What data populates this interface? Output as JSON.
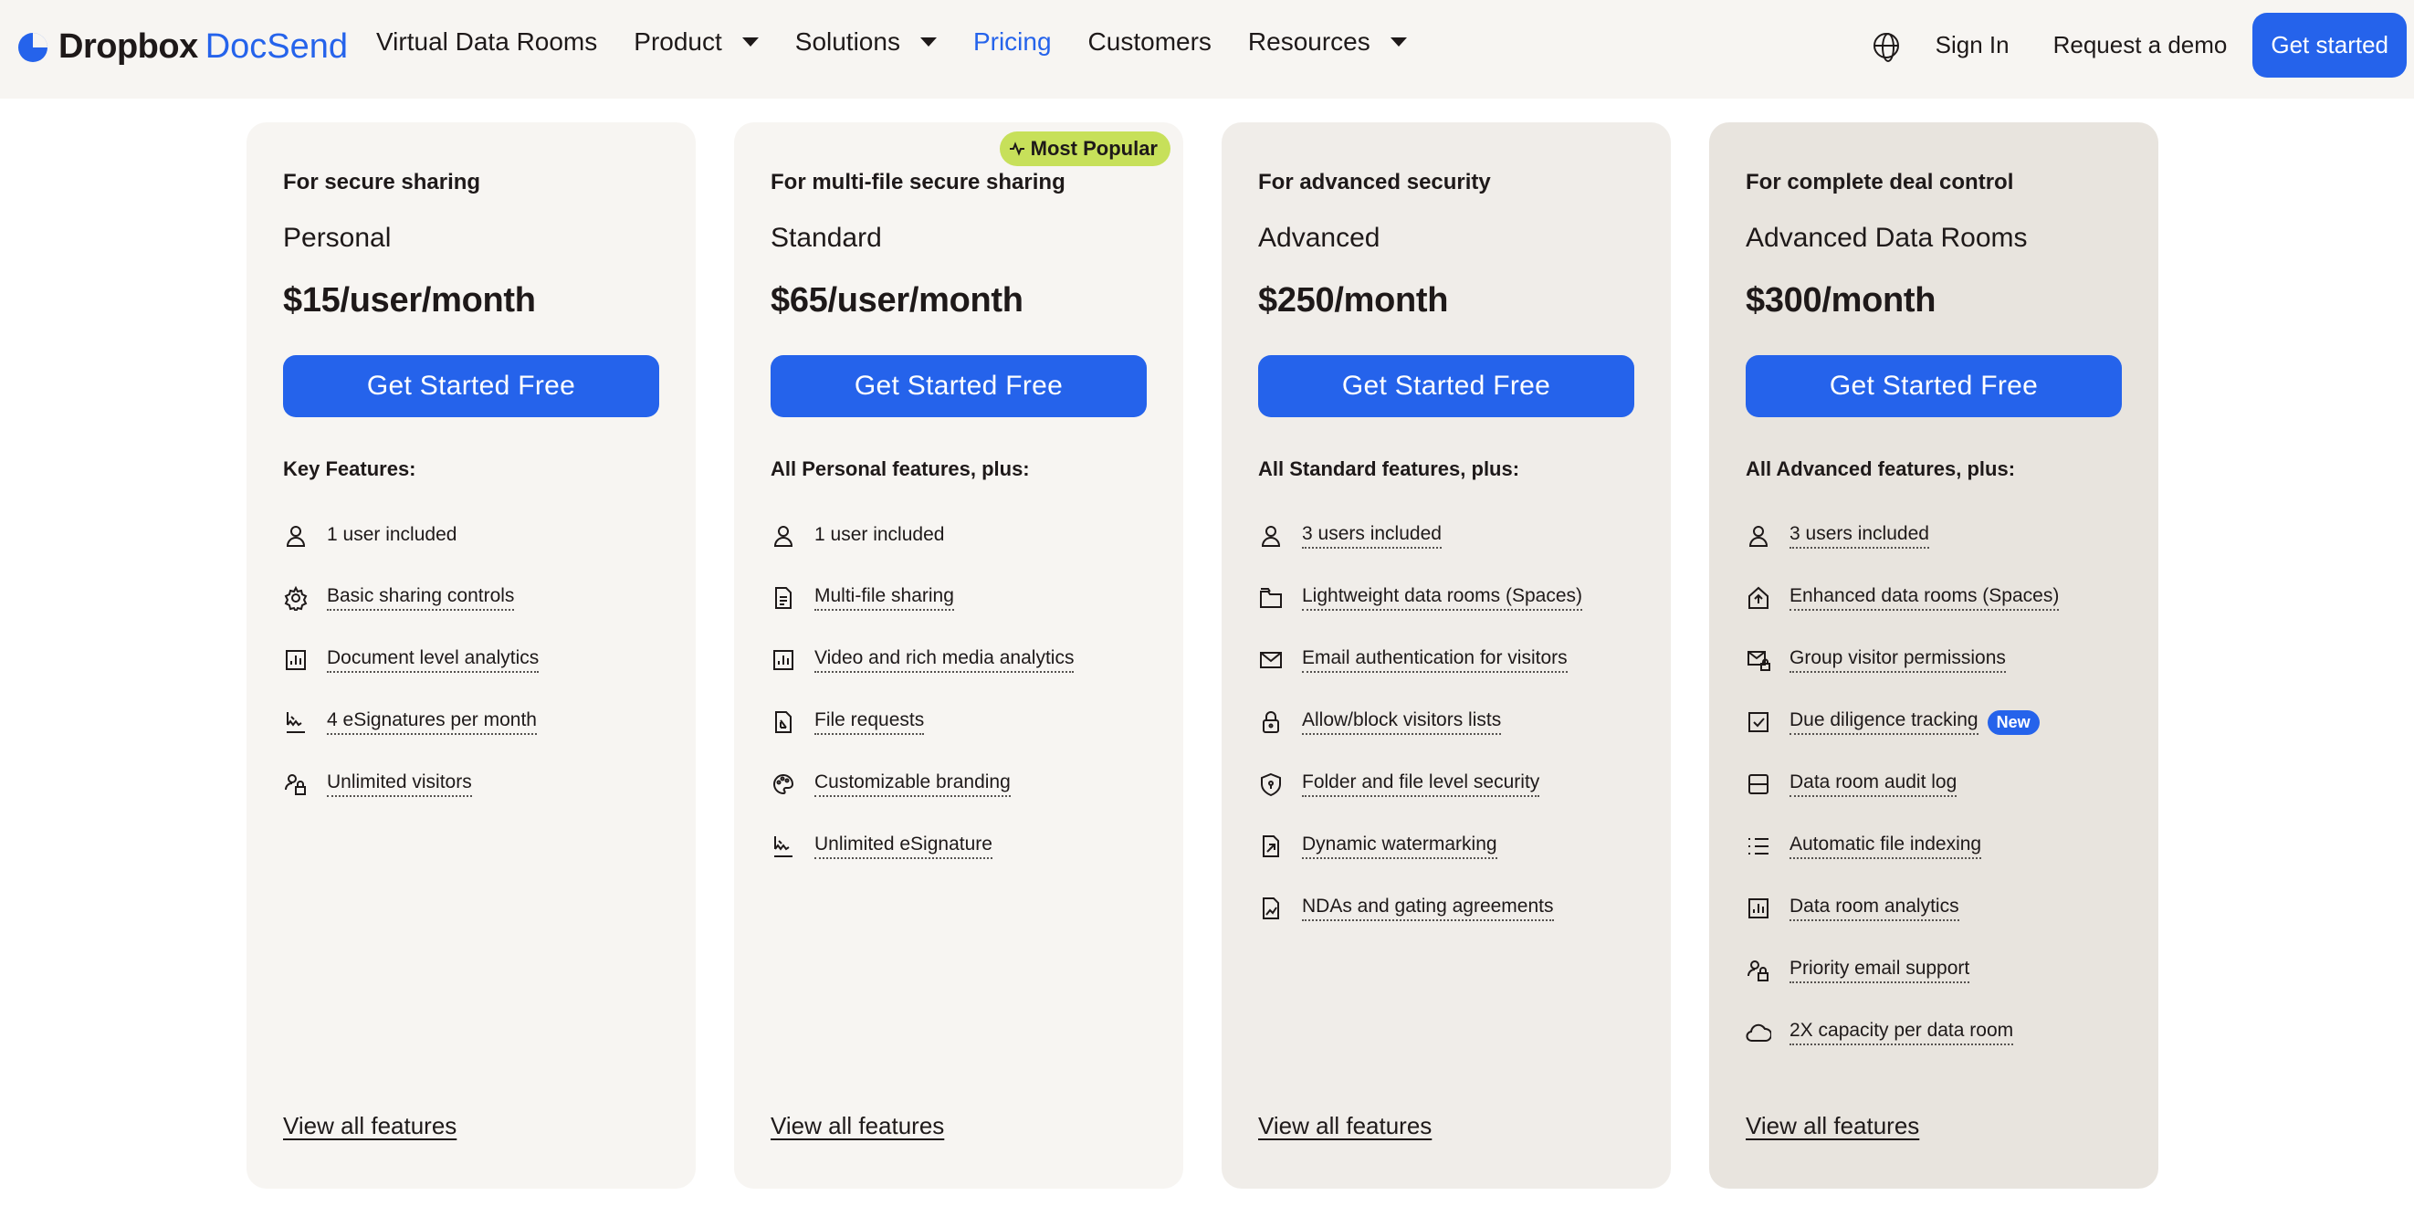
{
  "nav": {
    "logo_brand": "Dropbox",
    "logo_product": "DocSend",
    "links": [
      {
        "label": "Virtual Data Rooms",
        "dropdown": false,
        "active": false
      },
      {
        "label": "Product",
        "dropdown": true,
        "active": false
      },
      {
        "label": "Solutions",
        "dropdown": true,
        "active": false
      },
      {
        "label": "Pricing",
        "dropdown": false,
        "active": true
      },
      {
        "label": "Customers",
        "dropdown": false,
        "active": false
      },
      {
        "label": "Resources",
        "dropdown": true,
        "active": false
      }
    ],
    "sign_in": "Sign In",
    "request_demo": "Request a demo",
    "get_started": "Get started",
    "globe_icon": "globe-icon"
  },
  "colors": {
    "accent": "#2563eb",
    "badge": "#c7e05a",
    "text": "#1e1919"
  },
  "plans": [
    {
      "tagline": "For secure sharing",
      "name": "Personal",
      "price": "$15/user/month",
      "cta": "Get Started Free",
      "features_heading": "Key Features:",
      "features": [
        {
          "label": "1 user included",
          "icon": "user-icon",
          "underline": false
        },
        {
          "label": "Basic sharing controls",
          "icon": "gear-icon",
          "underline": true
        },
        {
          "label": "Document level analytics",
          "icon": "chart-icon",
          "underline": true
        },
        {
          "label": "4 eSignatures per month",
          "icon": "signature-icon",
          "underline": true
        },
        {
          "label": "Unlimited visitors",
          "icon": "visitors-icon",
          "underline": true
        }
      ],
      "view_all": "View all features"
    },
    {
      "tagline": "For multi-file secure sharing",
      "name": "Standard",
      "price": "$65/user/month",
      "badge": "Most Popular",
      "cta": "Get Started Free",
      "features_heading": "All Personal features, plus:",
      "features": [
        {
          "label": "1 user included",
          "icon": "user-icon",
          "underline": false
        },
        {
          "label": "Multi-file sharing",
          "icon": "document-icon",
          "underline": true
        },
        {
          "label": "Video and rich media analytics",
          "icon": "chart-icon",
          "underline": true
        },
        {
          "label": "File requests",
          "icon": "file-request-icon",
          "underline": true
        },
        {
          "label": "Customizable branding",
          "icon": "palette-icon",
          "underline": true
        },
        {
          "label": "Unlimited eSignature",
          "icon": "signature-icon",
          "underline": true
        }
      ],
      "view_all": "View all features"
    },
    {
      "tagline": "For advanced security",
      "name": "Advanced",
      "price": "$250/month",
      "cta": "Get Started Free",
      "features_heading": "All Standard features, plus:",
      "features": [
        {
          "label": "3 users included",
          "icon": "user-icon",
          "underline": true
        },
        {
          "label": "Lightweight data rooms (Spaces)",
          "icon": "folder-icon",
          "underline": true
        },
        {
          "label": "Email authentication for visitors",
          "icon": "mail-icon",
          "underline": true
        },
        {
          "label": "Allow/block visitors lists",
          "icon": "lock-icon",
          "underline": true
        },
        {
          "label": "Folder and file level security",
          "icon": "shield-icon",
          "underline": true
        },
        {
          "label": "Dynamic watermarking",
          "icon": "watermark-icon",
          "underline": true
        },
        {
          "label": "NDAs and gating agreements",
          "icon": "nda-icon",
          "underline": true
        }
      ],
      "view_all": "View all features"
    },
    {
      "tagline": "For complete deal control",
      "name": "Advanced Data Rooms",
      "price": "$300/month",
      "cta": "Get Started Free",
      "features_heading": "All Advanced features, plus:",
      "features": [
        {
          "label": "3 users included",
          "icon": "user-icon",
          "underline": true
        },
        {
          "label": "Enhanced data rooms (Spaces)",
          "icon": "house-icon",
          "underline": true
        },
        {
          "label": "Group visitor permissions",
          "icon": "mail-lock-icon",
          "underline": true
        },
        {
          "label": "Due diligence tracking",
          "icon": "checkbox-icon",
          "underline": true,
          "tag": "New"
        },
        {
          "label": "Data room audit log",
          "icon": "audit-icon",
          "underline": true
        },
        {
          "label": "Automatic file indexing",
          "icon": "list-icon",
          "underline": true
        },
        {
          "label": "Data room analytics",
          "icon": "chart-icon",
          "underline": true
        },
        {
          "label": "Priority email support",
          "icon": "visitors-icon",
          "underline": true
        },
        {
          "label": "2X capacity per data room",
          "icon": "cloud-icon",
          "underline": true
        }
      ],
      "view_all": "View all features"
    }
  ]
}
